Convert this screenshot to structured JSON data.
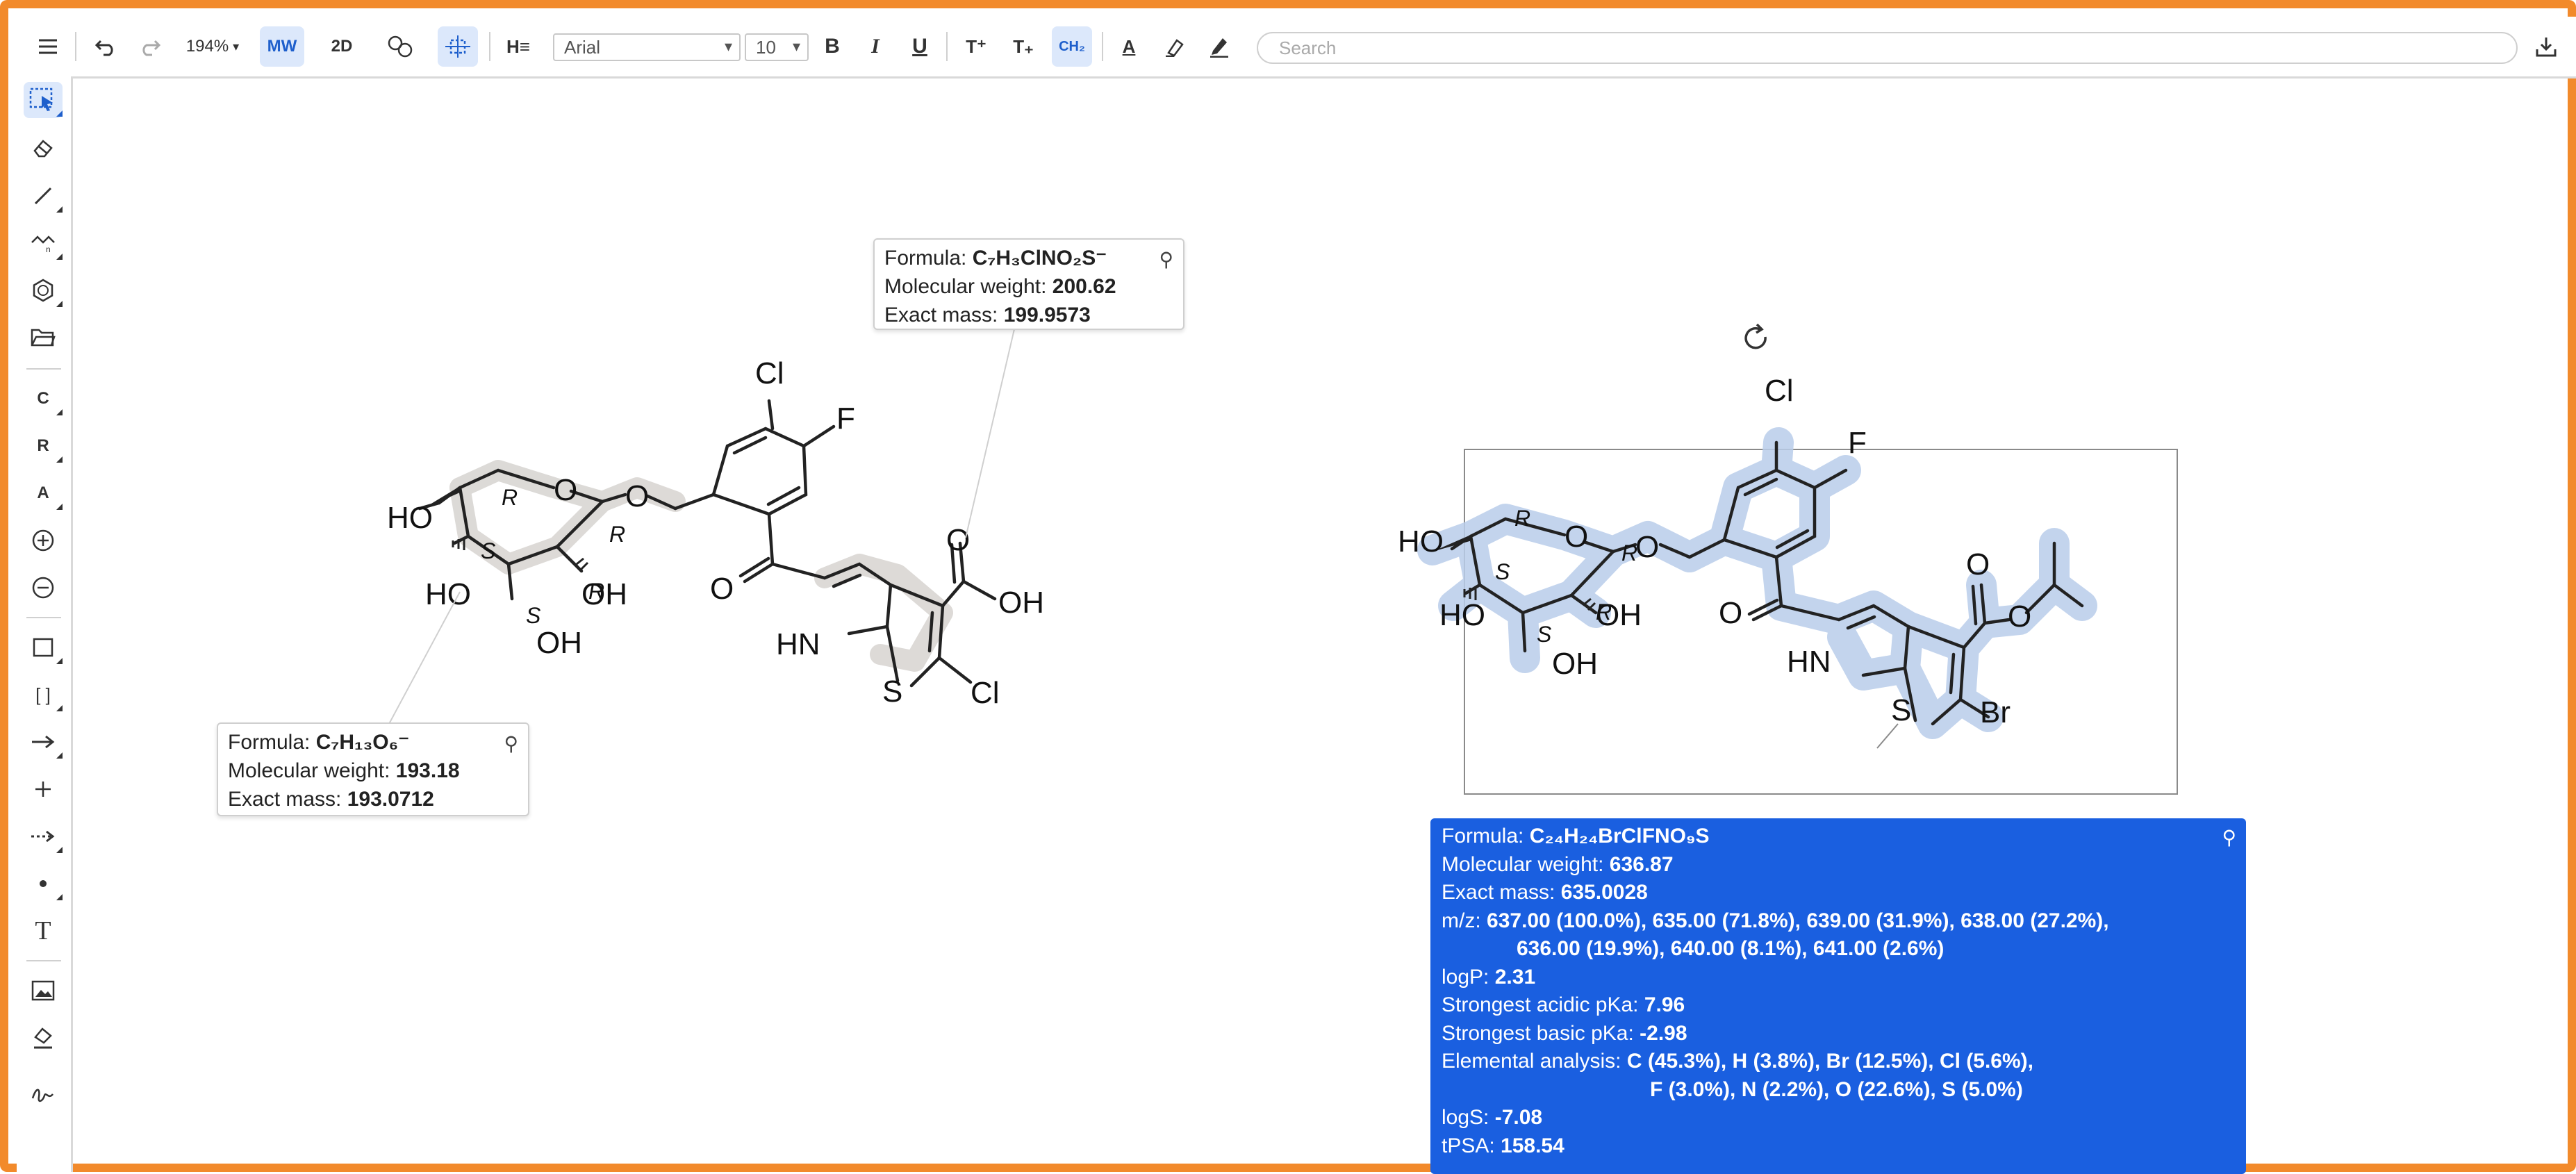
{
  "toolbar": {
    "zoom": "194%",
    "mw_label": "MW",
    "view_2d_label": "2D",
    "heading_label": "H≡",
    "font_family": "Arial",
    "font_size": "10",
    "bold_label": "B",
    "italic_label": "I",
    "underline_label": "U",
    "superscript_label": "T⁺",
    "subscript_label": "T₊",
    "formula_label": "CH₂",
    "text_color_label": "A",
    "search_placeholder": "Search",
    "icons": [
      "menu-icon",
      "undo-icon",
      "redo-icon",
      "clean-icon",
      "center-icon",
      "bold-icon",
      "italic-icon",
      "underline-icon",
      "marker-icon",
      "pen-icon",
      "download-icon"
    ]
  },
  "left_toolbar": {
    "atom_c": "C",
    "atom_r": "R",
    "atom_a": "A",
    "bracket_label": "[ ]",
    "text_tool": "T",
    "icons": [
      "select-icon",
      "eraser-icon",
      "bond-icon",
      "chain-icon",
      "ring-icon",
      "open-icon",
      "plus-charge-icon",
      "minus-charge-icon",
      "rectangle-icon",
      "arrow-icon",
      "plus-icon",
      "dotted-arrow-icon",
      "dot-icon",
      "image-icon",
      "paint-icon",
      "signature-icon"
    ]
  },
  "molecule_left": {
    "atoms": {
      "cl": "Cl",
      "f": "F",
      "oh_acid": "OH",
      "o_acid": "O",
      "o_ketone": "O",
      "hn": "HN",
      "s": "S",
      "cl_thio": "Cl",
      "ho_top": "HO",
      "ho_mid": "HO",
      "oh_right": "OH",
      "oh_bottom": "OH",
      "ring_o": "O",
      "ether_o": "O"
    },
    "stereo": {
      "r1": "R",
      "r2": "R",
      "s1": "S",
      "r3": "R",
      "s2": "S"
    }
  },
  "tooltip_thiophene": {
    "formula_label": "Formula:",
    "formula": "C₇H₃ClNO₂S⁻",
    "mw_label": "Molecular weight:",
    "mw_value": "200.62",
    "mass_label": "Exact mass:",
    "mass_value": "199.9573"
  },
  "tooltip_sugar": {
    "formula_label": "Formula:",
    "formula": "C₇H₁₃O₆⁻",
    "mw_label": "Molecular weight:",
    "mw_value": "193.18",
    "mass_label": "Exact mass:",
    "mass_value": "193.0712"
  },
  "molecule_right": {
    "atoms": {
      "cl": "Cl",
      "f": "F",
      "o_ketone": "O",
      "o_ester": "O",
      "o_ester2": "O",
      "hn": "HN",
      "s": "S",
      "br": "Br",
      "ho_top": "HO",
      "ho_mid": "HO",
      "oh_right": "OH",
      "oh_bottom": "OH",
      "ring_o": "O",
      "ether_o": "O"
    },
    "stereo": {
      "r1": "R",
      "r2": "R",
      "s1": "S",
      "r3": "R",
      "s2": "S"
    }
  },
  "infobox": {
    "formula_label": "Formula:",
    "formula": "C₂₄H₂₄BrClFNO₉S",
    "mw_label": "Molecular weight:",
    "mw_value": "636.87",
    "mass_label": "Exact mass:",
    "mass_value": "635.0028",
    "mz_label": "m/z:",
    "mz_line1": "637.00 (100.0%), 635.00 (71.8%), 639.00 (31.9%), 638.00 (27.2%),",
    "mz_line2": "636.00 (19.9%), 640.00 (8.1%), 641.00 (2.6%)",
    "logp_label": "logP:",
    "logp_value": "2.31",
    "acid_label": "Strongest acidic pKa:",
    "acid_value": "7.96",
    "base_label": "Strongest basic pKa:",
    "base_value": "-2.98",
    "elem_label": "Elemental analysis:",
    "elem_line1": "C (45.3%), H (3.8%), Br (12.5%), Cl (5.6%),",
    "elem_line2": "F (3.0%), N (2.2%), O (22.6%), S (5.0%)",
    "logs_label": "logS:",
    "logs_value": "-7.08",
    "tpsa_label": "tPSA:",
    "tpsa_value": "158.54"
  }
}
